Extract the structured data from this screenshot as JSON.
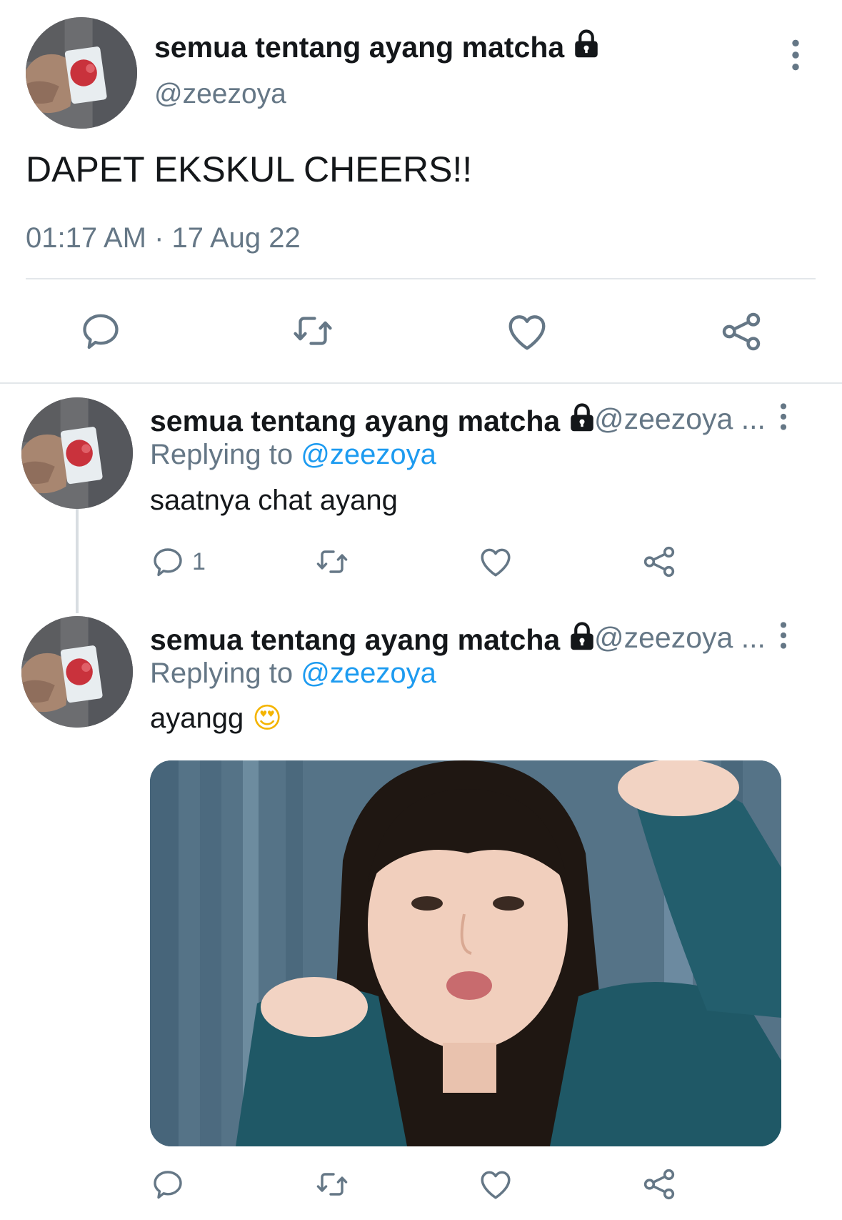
{
  "main_tweet": {
    "display_name": "semua tentang ayang matcha",
    "handle": "@zeezoya",
    "text": "DAPET EKSKUL CHEERS!!",
    "timestamp": "01:17 AM · 17 Aug 22",
    "icons": {
      "lock": "lock-icon",
      "more": "more-vertical-icon",
      "reply": "reply-icon",
      "retweet": "retweet-icon",
      "like": "heart-icon",
      "share": "share-icon"
    }
  },
  "replies": [
    {
      "display_name": "semua tentang ayang matcha",
      "handle": "@zeezoya ...",
      "replying_prefix": "Replying to",
      "replying_to": "@zeezoya",
      "text": "saatnya chat ayang",
      "reply_count": "1"
    },
    {
      "display_name": "semua tentang ayang matcha",
      "handle": "@zeezoya ...",
      "replying_prefix": "Replying to",
      "replying_to": "@zeezoya",
      "text": "ayangg",
      "emoji": "😍",
      "has_media": true
    }
  ],
  "colors": {
    "text_primary": "#14171a",
    "text_secondary": "#657786",
    "link": "#1d9bf0",
    "divider": "#e3e7ea"
  }
}
